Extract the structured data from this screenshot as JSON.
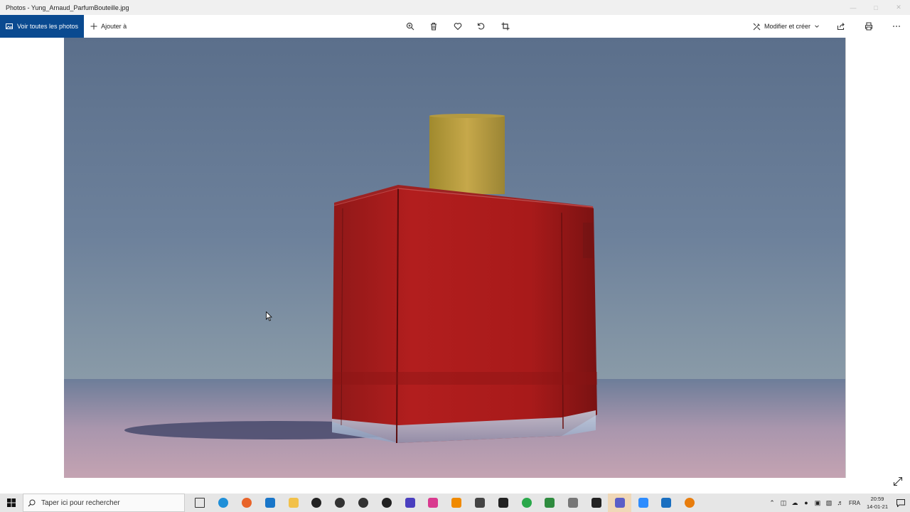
{
  "window": {
    "title": "Photos - Yung_Arnaud_ParfumBouteille.jpg",
    "controls": [
      "minimize-icon",
      "maximize-icon",
      "close-icon"
    ]
  },
  "toolbar": {
    "view_all_label": "Voir toutes les photos",
    "add_to_label": "Ajouter à",
    "center_tools": [
      "zoom-icon",
      "delete-icon",
      "favorite-icon",
      "rotate-icon",
      "crop-icon"
    ],
    "edit_create_label": "Modifier et créer",
    "right_tools": [
      "share-icon",
      "print-icon",
      "more-icon"
    ]
  },
  "taskbar": {
    "search_placeholder": "Taper ici pour rechercher",
    "apps": [
      {
        "name": "task-view-icon",
        "color": "#333333"
      },
      {
        "name": "edge-icon",
        "color": "#1f8fd8"
      },
      {
        "name": "firefox-icon",
        "color": "#e8642a"
      },
      {
        "name": "mail-icon",
        "color": "#1976c9"
      },
      {
        "name": "file-explorer-icon",
        "color": "#f2c14a"
      },
      {
        "name": "app-s-icon",
        "color": "#222222"
      },
      {
        "name": "davinci-icon",
        "color": "#333333"
      },
      {
        "name": "davinci-alt-icon",
        "color": "#333333"
      },
      {
        "name": "unity-icon",
        "color": "#222222"
      },
      {
        "name": "headset-icon",
        "color": "#4a3fbf"
      },
      {
        "name": "instagram-icon",
        "color": "#d93a8f"
      },
      {
        "name": "vlc-icon",
        "color": "#f08a00"
      },
      {
        "name": "app-tool-icon",
        "color": "#444444"
      },
      {
        "name": "inkscape-icon",
        "color": "#222222"
      },
      {
        "name": "color-wheel-icon",
        "color": "#2aa84a"
      },
      {
        "name": "spreadsheet-icon",
        "color": "#2e8b3e"
      },
      {
        "name": "notepad-icon",
        "color": "#777777"
      },
      {
        "name": "sticky-notes-icon",
        "color": "#222222"
      },
      {
        "name": "teams-icon",
        "color": "#5b5fc7"
      },
      {
        "name": "zoom-app-icon",
        "color": "#2d8cff"
      },
      {
        "name": "photos-app-icon",
        "color": "#1a6fc0"
      },
      {
        "name": "blender-icon",
        "color": "#e87d0d"
      }
    ],
    "tray_language": "FRA",
    "time": "20:59",
    "date": "14-01-21"
  },
  "colors": {
    "accent": "#0a4a90",
    "taskbar": "#e6e6e6"
  }
}
